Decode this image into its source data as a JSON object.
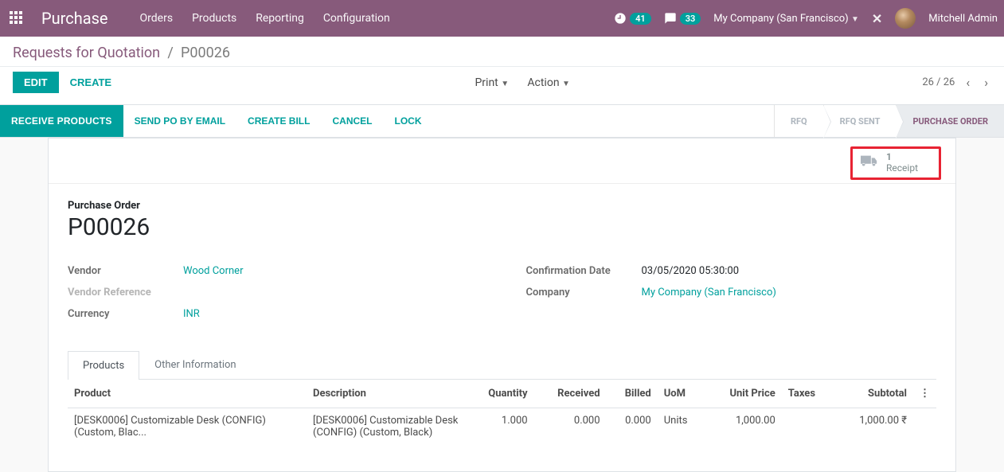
{
  "nav": {
    "brand": "Purchase",
    "links": [
      "Orders",
      "Products",
      "Reporting",
      "Configuration"
    ],
    "counter1": "41",
    "counter2": "33",
    "company": "My Company (San Francisco)",
    "user": "Mitchell Admin"
  },
  "breadcrumb": {
    "root": "Requests for Quotation",
    "current": "P00026"
  },
  "controls": {
    "edit": "EDIT",
    "create": "CREATE",
    "print": "Print",
    "action": "Action",
    "pager": "26 / 26"
  },
  "statusbar": {
    "receive": "RECEIVE PRODUCTS",
    "sendpo": "SEND PO BY EMAIL",
    "createbill": "CREATE BILL",
    "cancel": "CANCEL",
    "lock": "LOCK",
    "stages": [
      "RFQ",
      "RFQ SENT",
      "PURCHASE ORDER"
    ]
  },
  "stat_button": {
    "count": "1",
    "label": "Receipt"
  },
  "sheet": {
    "title_label": "Purchase Order",
    "title": "P00026",
    "vendor_label": "Vendor",
    "vendor": "Wood Corner",
    "vendor_ref_label": "Vendor Reference",
    "currency_label": "Currency",
    "currency": "INR",
    "confirm_label": "Confirmation Date",
    "confirm": "03/05/2020 05:30:00",
    "company_label": "Company",
    "company": "My Company (San Francisco)"
  },
  "tabs": {
    "products": "Products",
    "other": "Other Information"
  },
  "table": {
    "headers": {
      "product": "Product",
      "description": "Description",
      "quantity": "Quantity",
      "received": "Received",
      "billed": "Billed",
      "uom": "UoM",
      "unit_price": "Unit Price",
      "taxes": "Taxes",
      "subtotal": "Subtotal"
    },
    "rows": [
      {
        "product": "[DESK0006] Customizable Desk (CONFIG) (Custom, Blac...",
        "description": "[DESK0006] Customizable Desk (CONFIG) (Custom, Black)",
        "quantity": "1.000",
        "received": "0.000",
        "billed": "0.000",
        "uom": "Units",
        "unit_price": "1,000.00",
        "taxes": "",
        "subtotal": "1,000.00 ₹"
      }
    ]
  }
}
